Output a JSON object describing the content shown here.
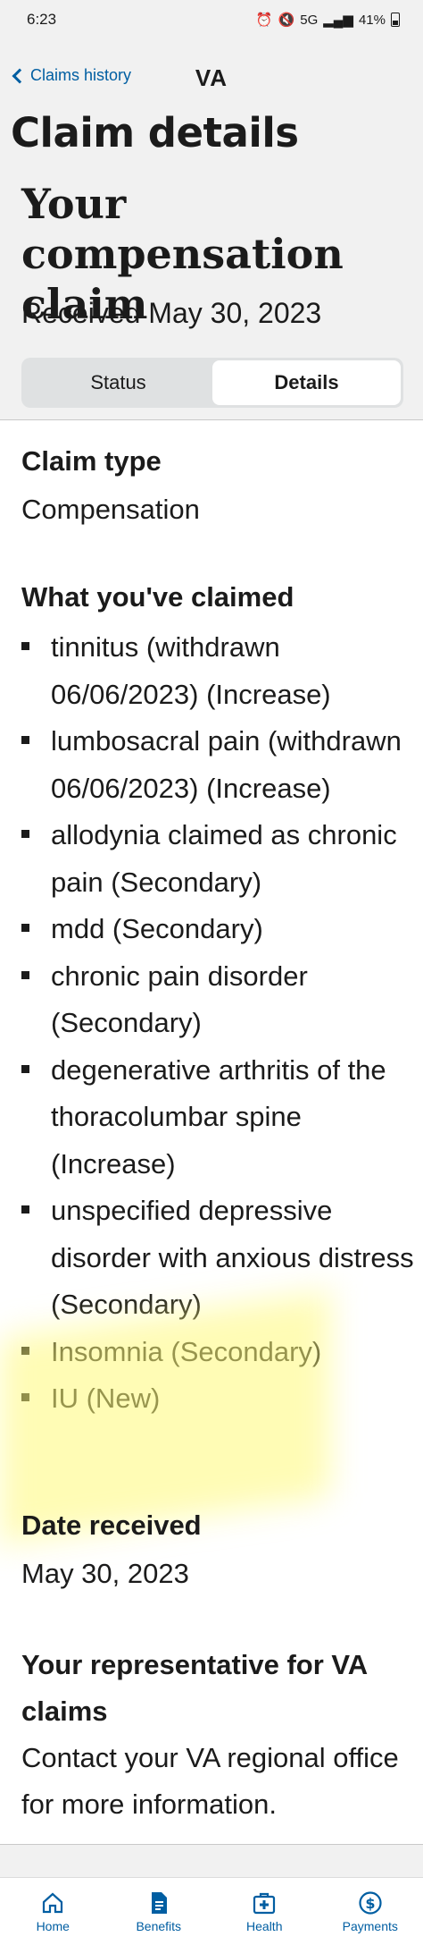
{
  "status_bar": {
    "time": "6:23",
    "network": "5G",
    "battery": "41%"
  },
  "nav": {
    "back_label": "Claims history",
    "title": "VA"
  },
  "page_title": "Claim details",
  "claim": {
    "title": "Your compensation claim",
    "received": "Received May 30, 2023"
  },
  "tabs": [
    {
      "label": "Status",
      "active": false
    },
    {
      "label": "Details",
      "active": true
    }
  ],
  "details": {
    "claim_type_label": "Claim type",
    "claim_type_value": "Compensation",
    "claimed_label": "What you've claimed",
    "claimed_items": [
      "tinnitus (withdrawn 06/06/2023) (Increase)",
      "lumbosacral pain (withdrawn 06/06/2023) (Increase)",
      "allodynia claimed as chronic pain (Secondary)",
      "mdd (Secondary)",
      "chronic pain disorder (Secondary)",
      "degenerative arthritis of the thoracolumbar spine (Increase)",
      "unspecified depressive disorder with anxious distress (Secondary)",
      "Insomnia (Secondary)",
      "IU (New)"
    ],
    "date_label": "Date received",
    "date_value": "May 30, 2023",
    "rep_label": "Your representative for VA claims",
    "rep_text": "Contact your VA regional office for more information."
  },
  "bottom_nav": [
    {
      "label": "Home",
      "icon": "home-icon"
    },
    {
      "label": "Benefits",
      "icon": "benefits-icon"
    },
    {
      "label": "Health",
      "icon": "health-icon"
    },
    {
      "label": "Payments",
      "icon": "payments-icon"
    }
  ],
  "colors": {
    "link": "#005ea2",
    "background": "#f1f1f1",
    "text": "#1b1b1b"
  }
}
